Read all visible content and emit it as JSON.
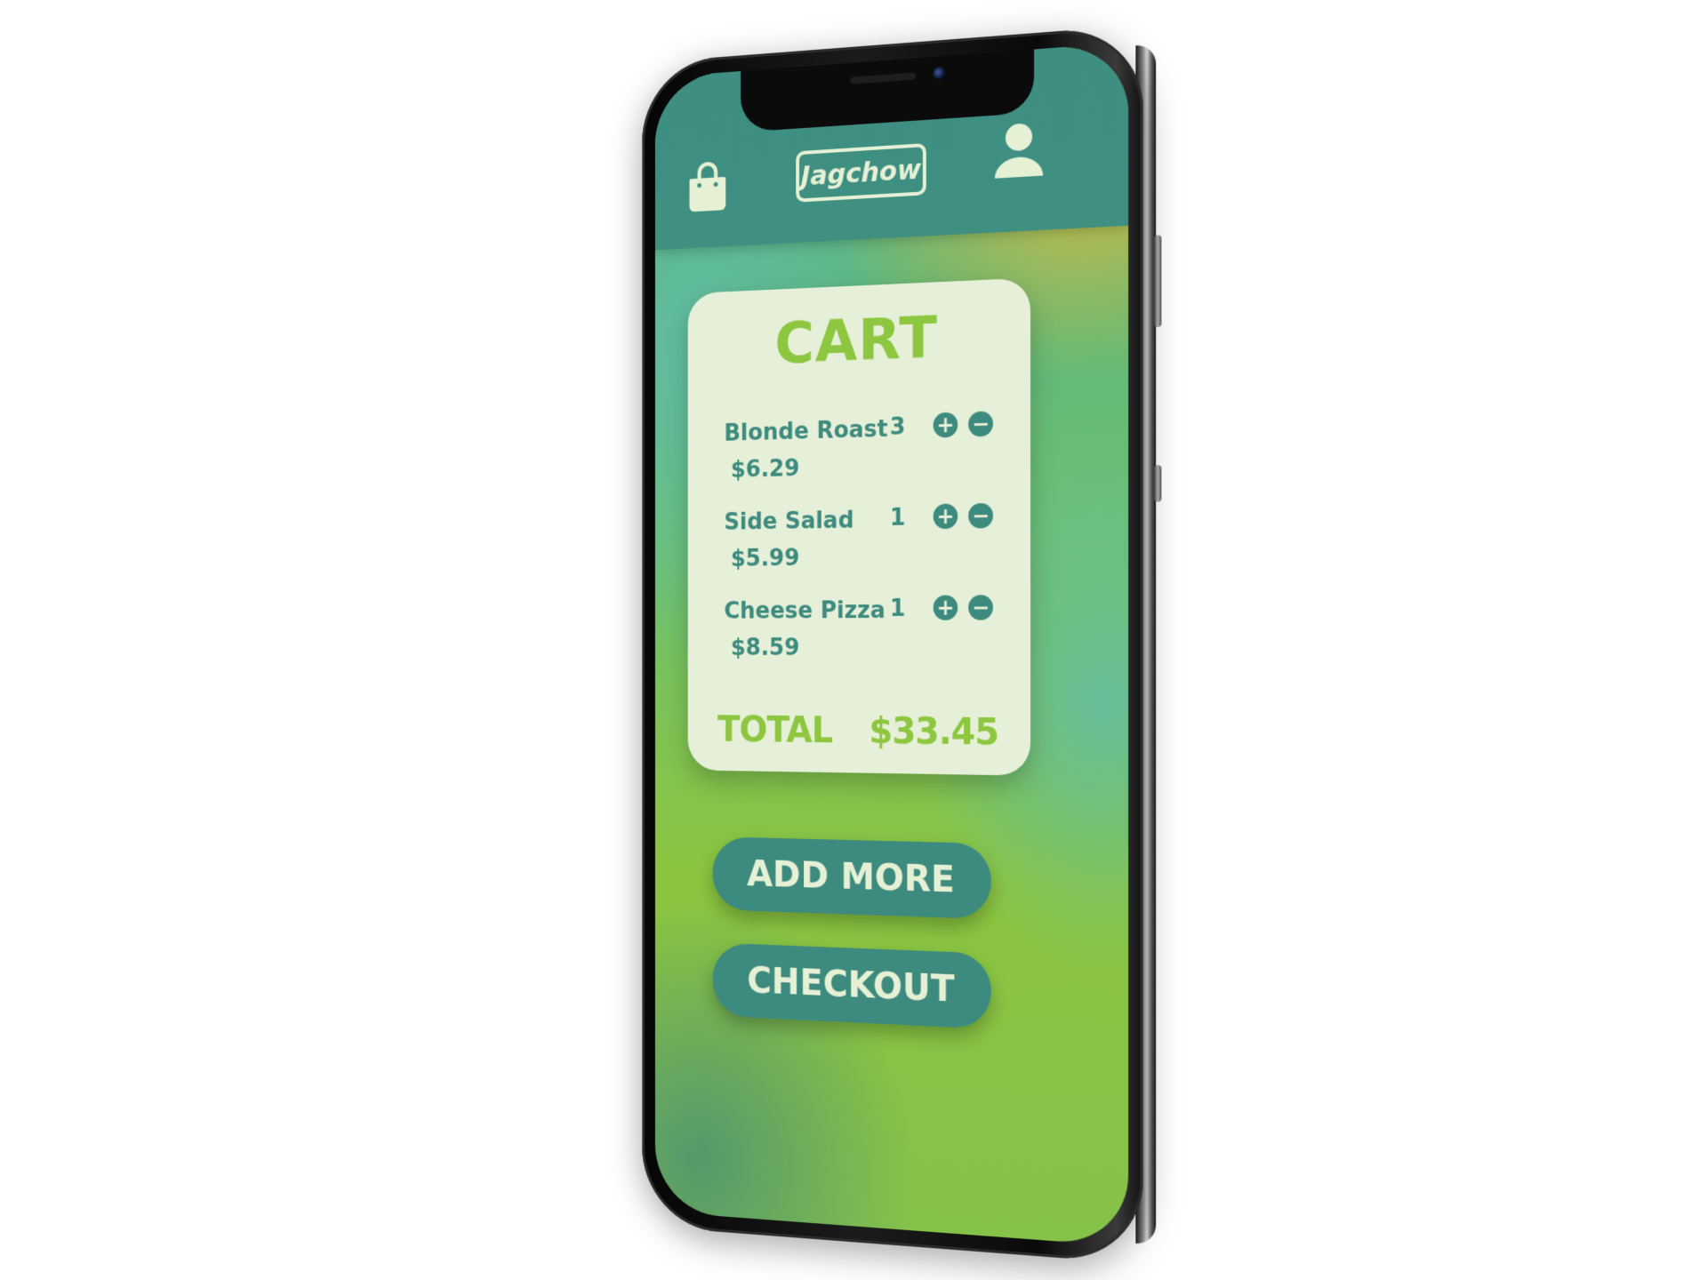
{
  "app": {
    "logo_text": "Jagchow"
  },
  "header": {
    "bag_icon": "shopping-bag-icon",
    "user_icon": "user-icon"
  },
  "cart": {
    "title": "CART",
    "items": [
      {
        "name": "Blonde Roast",
        "quantity": "3",
        "price": "$6.29"
      },
      {
        "name": "Side Salad",
        "quantity": "1",
        "price": "$5.99"
      },
      {
        "name": "Cheese Pizza",
        "quantity": "1",
        "price": "$8.59"
      }
    ],
    "increment_icon": "plus-circle-icon",
    "decrement_icon": "minus-circle-icon",
    "total_label": "TOTAL",
    "total_value": "$33.45"
  },
  "actions": {
    "add_more_label": "ADD MORE",
    "checkout_label": "CHECKOUT"
  },
  "colors": {
    "primary": "#3d8b7e",
    "accent": "#8dc63f",
    "card": "#e6f0d8"
  }
}
